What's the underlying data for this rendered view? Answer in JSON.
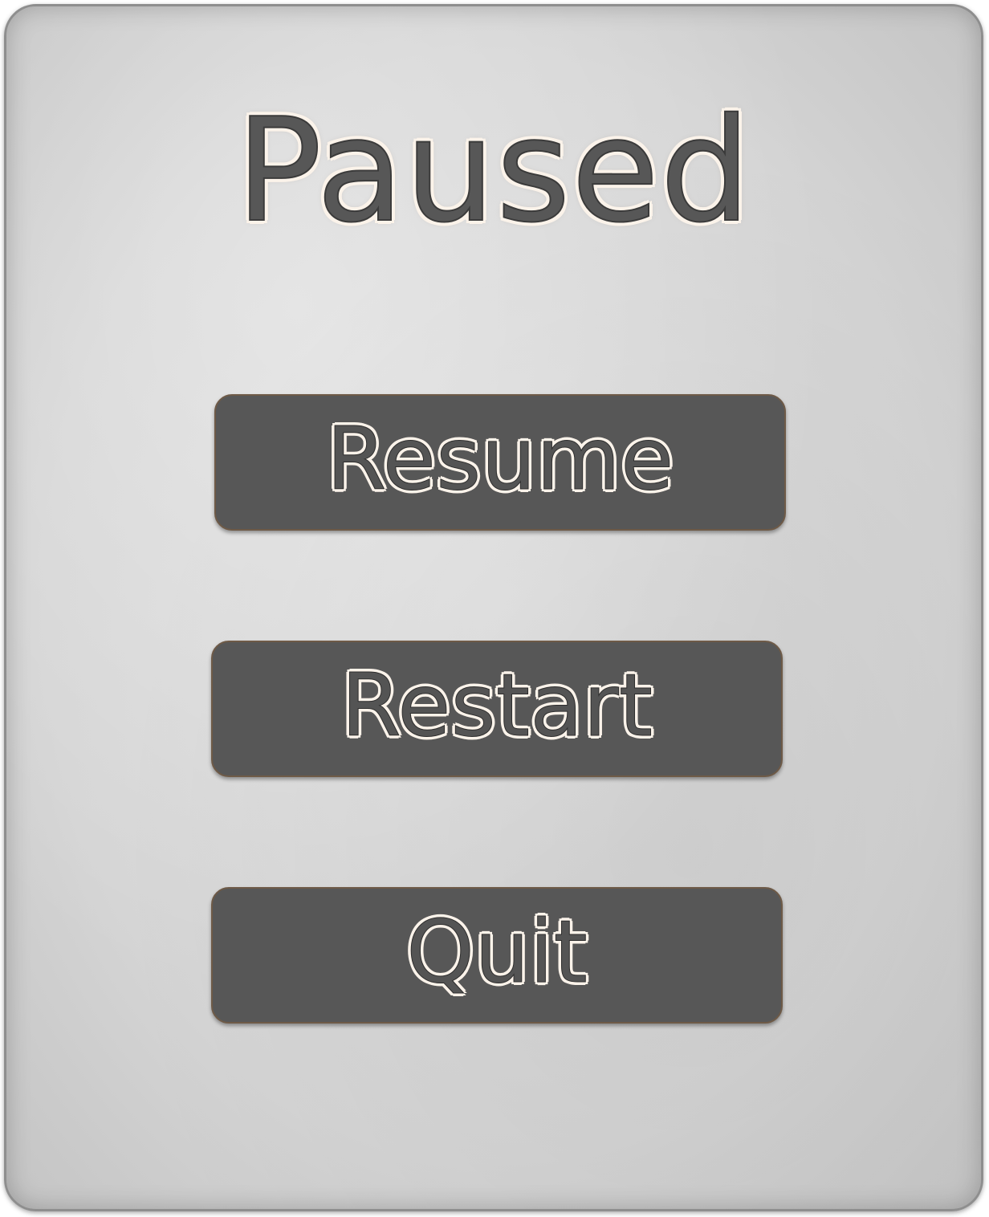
{
  "pause_menu": {
    "title": "Paused",
    "buttons": {
      "resume": "Resume",
      "restart": "Restart",
      "quit": "Quit"
    }
  },
  "colors": {
    "panel_background": "#d8d8d8",
    "button_fill": "#575757",
    "button_border": "#6e5a47",
    "text_fill": "#545454",
    "text_outline": "#fbf3ea"
  }
}
